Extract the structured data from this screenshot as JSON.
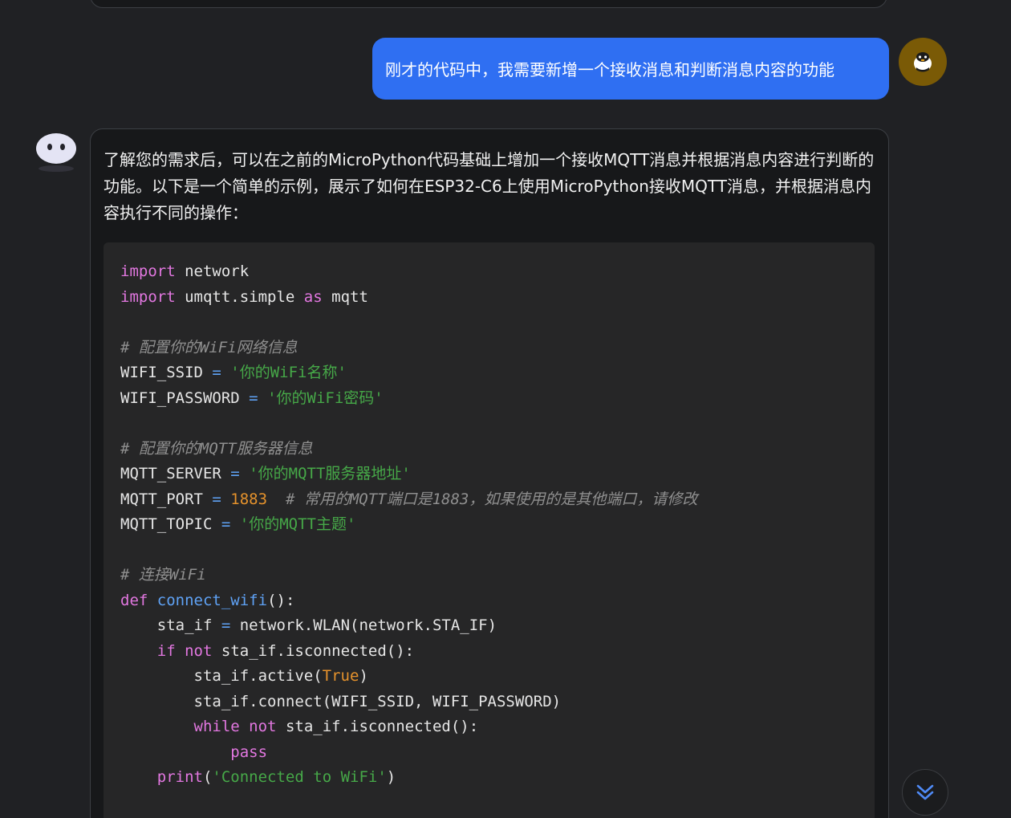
{
  "user_message": {
    "text": "刚才的代码中，我需要新增一个接收消息和判断消息内容的功能"
  },
  "assistant_message": {
    "text": "了解您的需求后，可以在之前的MicroPython代码基础上增加一个接收MQTT消息并根据消息内容进行判断的功能。以下是一个简单的示例，展示了如何在ESP32-C6上使用MicroPython接收MQTT消息，并根据消息内容执行不同的操作："
  },
  "code": {
    "language": "python",
    "tokens": {
      "import": "import",
      "as": "as",
      "def": "def",
      "if": "if",
      "not": "not",
      "while": "while",
      "pass": "pass",
      "print": "print",
      "true": "True"
    },
    "l1_module": " network",
    "l2_module": " umqtt.simple ",
    "l2_alias": " mqtt",
    "comment_wifi_config": "# 配置你的WiFi网络信息",
    "wifi_ssid_name": "WIFI_SSID ",
    "wifi_ssid_value": "'你的WiFi名称'",
    "wifi_password_name": "WIFI_PASSWORD ",
    "wifi_password_value": "'你的WiFi密码'",
    "comment_mqtt_config": "# 配置你的MQTT服务器信息",
    "mqtt_server_name": "MQTT_SERVER ",
    "mqtt_server_value": "'你的MQTT服务器地址'",
    "mqtt_port_name": "MQTT_PORT ",
    "mqtt_port_value": "1883",
    "mqtt_port_comment": "# 常用的MQTT端口是1883，如果使用的是其他端口，请修改",
    "mqtt_topic_name": "MQTT_TOPIC ",
    "mqtt_topic_value": "'你的MQTT主题'",
    "comment_connect": "# 连接WiFi",
    "func_name": "connect_wifi",
    "func_paren": "():",
    "sta_if_name": "    sta_if ",
    "sta_if_value": " network.WLAN(network.STA_IF)",
    "if_cond": " sta_if.isconnected():",
    "active_call": "        sta_if.active(",
    "close_paren": ")",
    "connect_call": "        sta_if.connect(WIFI_SSID, WIFI_PASSWORD)",
    "while_cond": " sta_if.isconnected():",
    "print_arg": "'Connected to WiFi'"
  },
  "controls": {
    "scroll_down_icon": "double-chevron-down-icon"
  },
  "colors": {
    "user_bubble": "#2f6ff2",
    "background": "#202124",
    "card": "#17181a",
    "code_bg": "#262627"
  }
}
